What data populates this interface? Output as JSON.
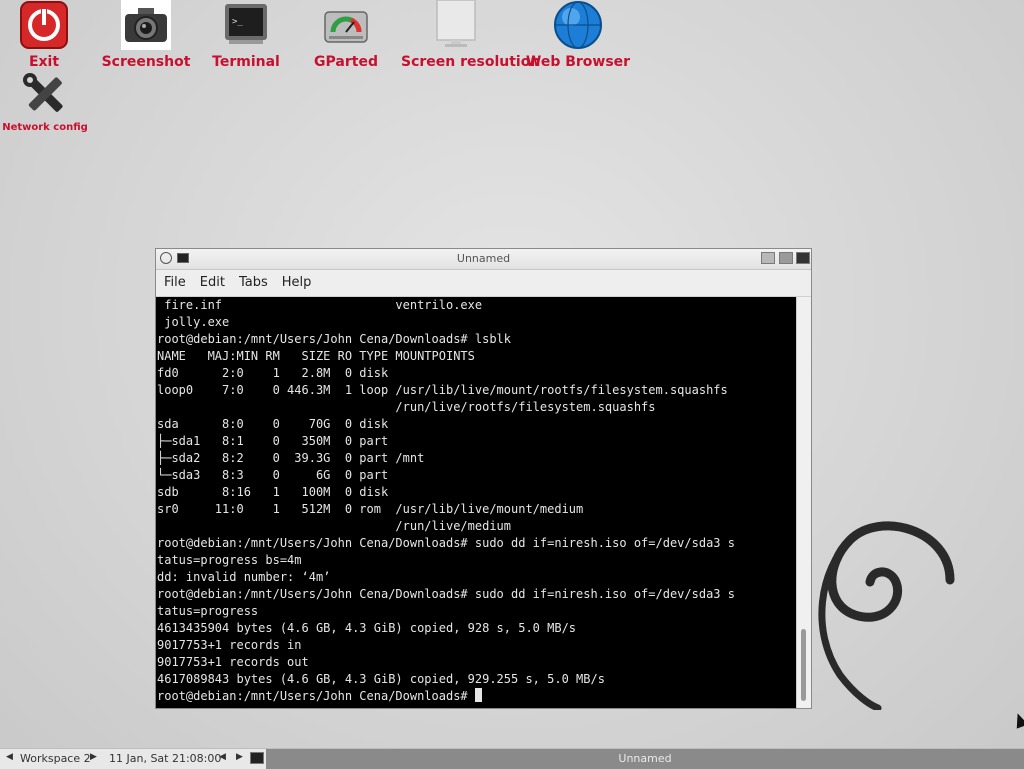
{
  "desktop": {
    "icons": [
      {
        "label": "Exit"
      },
      {
        "label": "Screenshot"
      },
      {
        "label": "Terminal"
      },
      {
        "label": "GParted"
      },
      {
        "label": "Screen resolution"
      },
      {
        "label": "Web Browser"
      },
      {
        "label": "Network config"
      }
    ]
  },
  "window": {
    "title": "Unnamed",
    "menu": [
      "File",
      "Edit",
      "Tabs",
      "Help"
    ]
  },
  "terminal": {
    "lines": [
      " fire.inf                        ventrilo.exe",
      " jolly.exe",
      "root@debian:/mnt/Users/John Cena/Downloads# lsblk",
      "NAME   MAJ:MIN RM   SIZE RO TYPE MOUNTPOINTS",
      "fd0      2:0    1   2.8M  0 disk",
      "loop0    7:0    0 446.3M  1 loop /usr/lib/live/mount/rootfs/filesystem.squashfs",
      "                                 /run/live/rootfs/filesystem.squashfs",
      "sda      8:0    0    70G  0 disk",
      "├─sda1   8:1    0   350M  0 part",
      "├─sda2   8:2    0  39.3G  0 part /mnt",
      "└─sda3   8:3    0     6G  0 part",
      "sdb      8:16   1   100M  0 disk",
      "sr0     11:0    1   512M  0 rom  /usr/lib/live/mount/medium",
      "                                 /run/live/medium",
      "root@debian:/mnt/Users/John Cena/Downloads# sudo dd if=niresh.iso of=/dev/sda3 s",
      "tatus=progress bs=4m",
      "dd: invalid number: ‘4m’",
      "root@debian:/mnt/Users/John Cena/Downloads# sudo dd if=niresh.iso of=/dev/sda3 s",
      "tatus=progress",
      "4613435904 bytes (4.6 GB, 4.3 GiB) copied, 928 s, 5.0 MB/s",
      "9017753+1 records in",
      "9017753+1 records out",
      "4617089843 bytes (4.6 GB, 4.3 GiB) copied, 929.255 s, 5.0 MB/s"
    ],
    "prompt": "root@debian:/mnt/Users/John Cena/Downloads# "
  },
  "taskbar": {
    "workspace": "Workspace 2",
    "clock": "11 Jan, Sat 21:08:00",
    "window_title": "Unnamed"
  }
}
